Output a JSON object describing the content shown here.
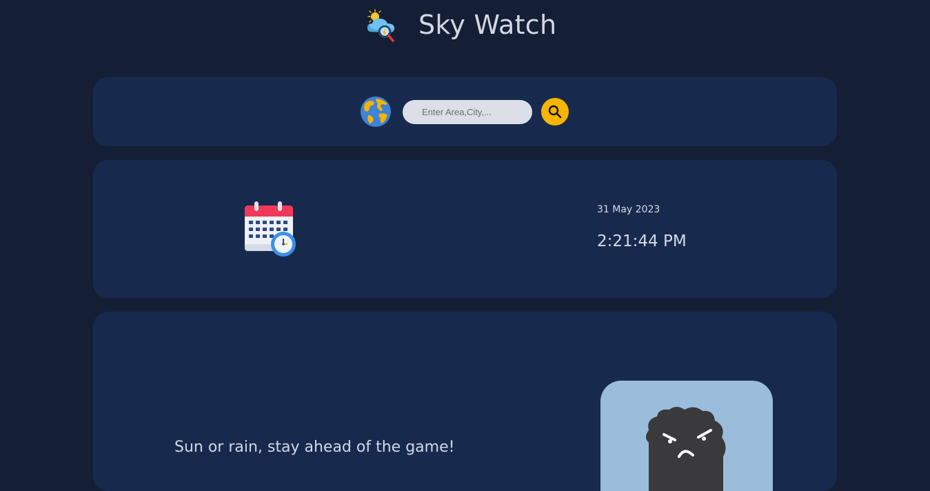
{
  "header": {
    "title": "Sky Watch",
    "logo_icon": "weather-cloud-icon"
  },
  "search": {
    "placeholder": "Enter Area,City,...",
    "value": "",
    "globe_icon": "globe-icon",
    "button_icon": "search-icon"
  },
  "datetime": {
    "icon": "calendar-clock-icon",
    "date": "31 May 2023",
    "time": "2:21:44 PM"
  },
  "hero": {
    "tagline": "Sun or rain, stay ahead of the game!",
    "illustration_icon": "angry-cloud-icon"
  },
  "colors": {
    "background": "#141f36",
    "card": "#172a4e",
    "accent": "#f7b500",
    "text": "#d3d8e4",
    "illustration_bg": "#9abddb"
  }
}
